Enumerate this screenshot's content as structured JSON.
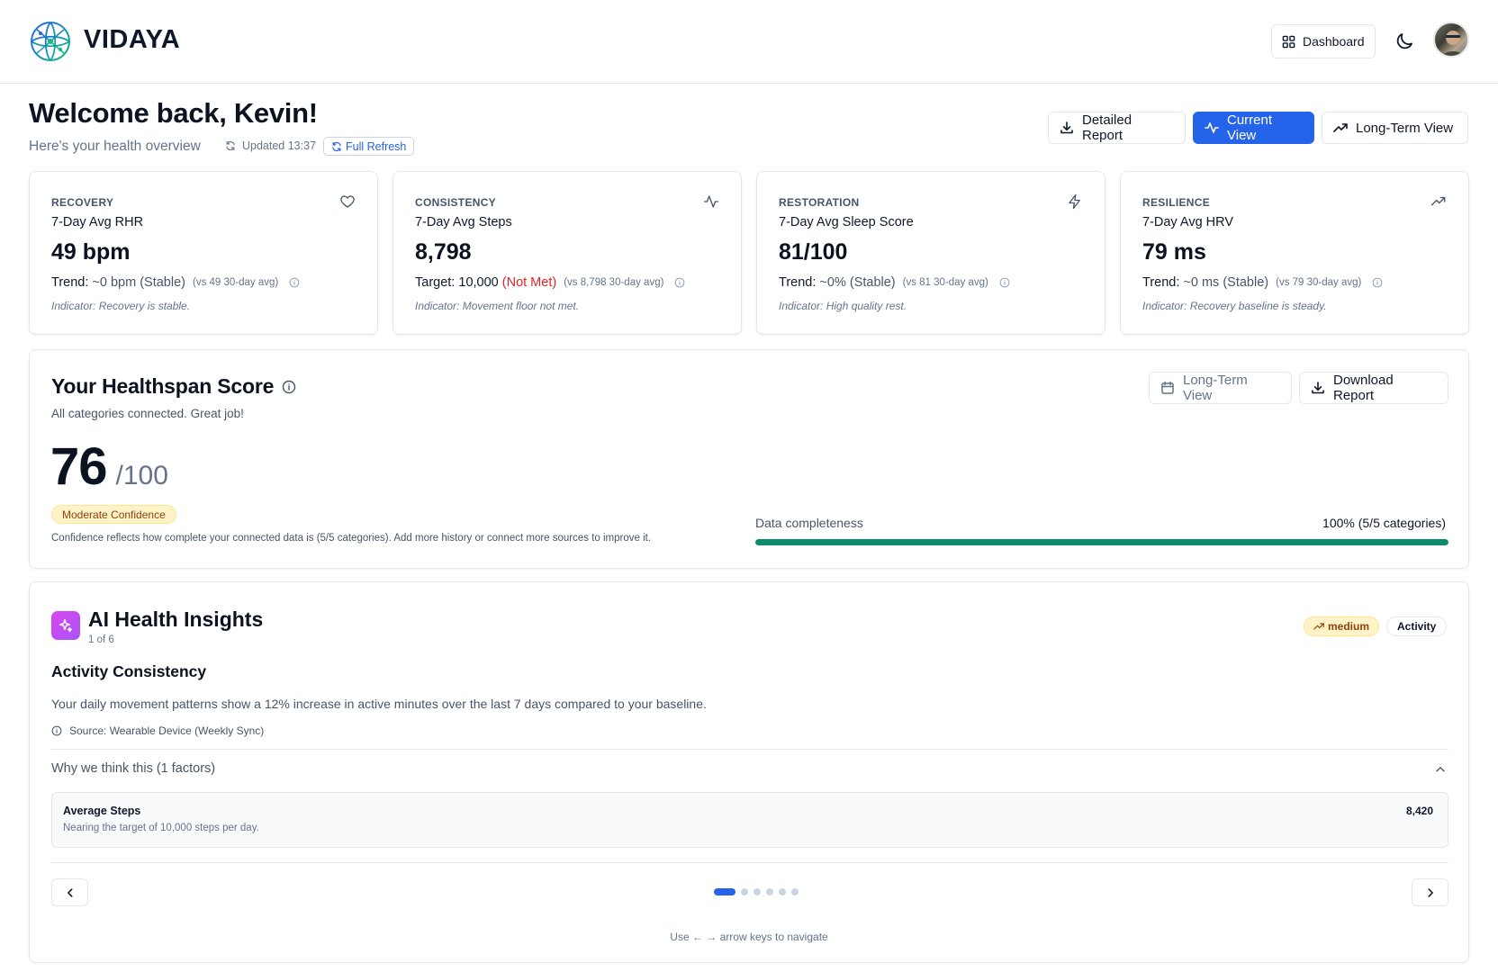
{
  "header": {
    "brand": "VIDAYA",
    "dashboard_label": "Dashboard"
  },
  "welcome": {
    "title": "Welcome back, Kevin!",
    "subtitle": "Here's your health overview",
    "updated": "Updated 13:37",
    "refresh_label": "Full Refresh",
    "buttons": {
      "detailed_report": "Detailed Report",
      "current_view": "Current View",
      "long_term_view": "Long-Term View"
    }
  },
  "cards": [
    {
      "category": "RECOVERY",
      "metric": "7-Day Avg RHR",
      "value": "49 bpm",
      "trend_label": "Trend:",
      "trend_value": "~0 bpm (Stable)",
      "comparison": "(vs 49 30-day avg)",
      "indicator": "Indicator: Recovery is stable.",
      "icon": "heart-icon"
    },
    {
      "category": "CONSISTENCY",
      "metric": "7-Day Avg Steps",
      "value": "8,798",
      "trend_label": "Target:",
      "trend_value": "10,000",
      "trend_status": "(Not Met)",
      "comparison": "(vs 8,798 30-day avg)",
      "indicator": "Indicator: Movement floor not met.",
      "icon": "activity-icon"
    },
    {
      "category": "RESTORATION",
      "metric": "7-Day Avg Sleep Score",
      "value": "81/100",
      "trend_label": "Trend:",
      "trend_value": "~0% (Stable)",
      "comparison": "(vs 81 30-day avg)",
      "indicator": "Indicator: High quality rest.",
      "icon": "lightning-icon"
    },
    {
      "category": "RESILIENCE",
      "metric": "7-Day Avg HRV",
      "value": "79 ms",
      "trend_label": "Trend:",
      "trend_value": "~0 ms (Stable)",
      "comparison": "(vs 79 30-day avg)",
      "indicator": "Indicator: Recovery baseline is steady.",
      "icon": "trending-up-icon"
    }
  ],
  "healthspan": {
    "title": "Your Healthspan Score",
    "subtitle": "All categories connected. Great job!",
    "score": "76",
    "score_max": "/100",
    "confidence": "Moderate Confidence",
    "note": "Confidence reflects how complete your connected data is (5/5 categories). Add more history or connect more sources to improve it.",
    "long_term_label": "Long-Term View",
    "download_label": "Download Report",
    "completeness_label": "Data completeness",
    "completeness_value": "100% (5/5 categories)",
    "completeness_fraction": 1.0
  },
  "insights": {
    "title": "AI Health Insights",
    "counter": "1 of 6",
    "priority": "medium",
    "category": "Activity",
    "heading": "Activity Consistency",
    "body": "Your daily movement patterns show a 12% increase in active minutes over the last 7 days compared to your baseline.",
    "source": "Source: Wearable Device (Weekly Sync)",
    "why_label": "Why we think this (1 factors)",
    "factors": [
      {
        "name": "Average Steps",
        "description": "Nearing the target of 10,000 steps per day.",
        "value": "8,420"
      }
    ],
    "page_count": 6,
    "active_page": 1,
    "hint": "Use ← → arrow keys to navigate"
  },
  "colors": {
    "accent": "#2563eb",
    "progress": "#0f8a6a",
    "warning_bg": "#fef3c7",
    "danger": "#dc2626"
  }
}
